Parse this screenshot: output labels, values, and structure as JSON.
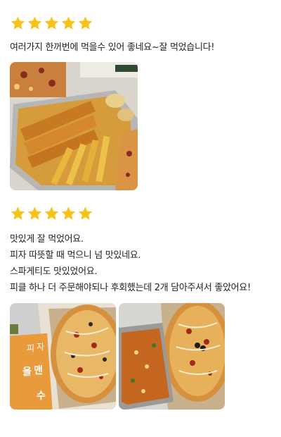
{
  "colors": {
    "star": "#F7C21B",
    "text": "#222222"
  },
  "reviews": [
    {
      "rating": 5,
      "lines": [
        "여러가지 한꺼번에 먹을수 있어 좋네요~잘 먹었습니다!"
      ],
      "photos": [
        {
          "icon": "food-photo-chicken-tenders-fries-pizza"
        }
      ]
    },
    {
      "rating": 5,
      "lines": [
        "맛있게 잘 먹었어요.",
        "피자 따뜻할 때 먹으니 넘 맛있네요.",
        "스파게티도 맛있었어요.",
        "피클 하나 더 주문해야되나 후회했는데 2개 담아주셔서 좋았어요!"
      ],
      "photos": [
        {
          "icon": "food-photo-pizza-box",
          "sign_text": [
            "피",
            "자",
            "올",
            "맨",
            "수"
          ]
        },
        {
          "icon": "food-photo-pizza-spaghetti"
        }
      ]
    }
  ]
}
